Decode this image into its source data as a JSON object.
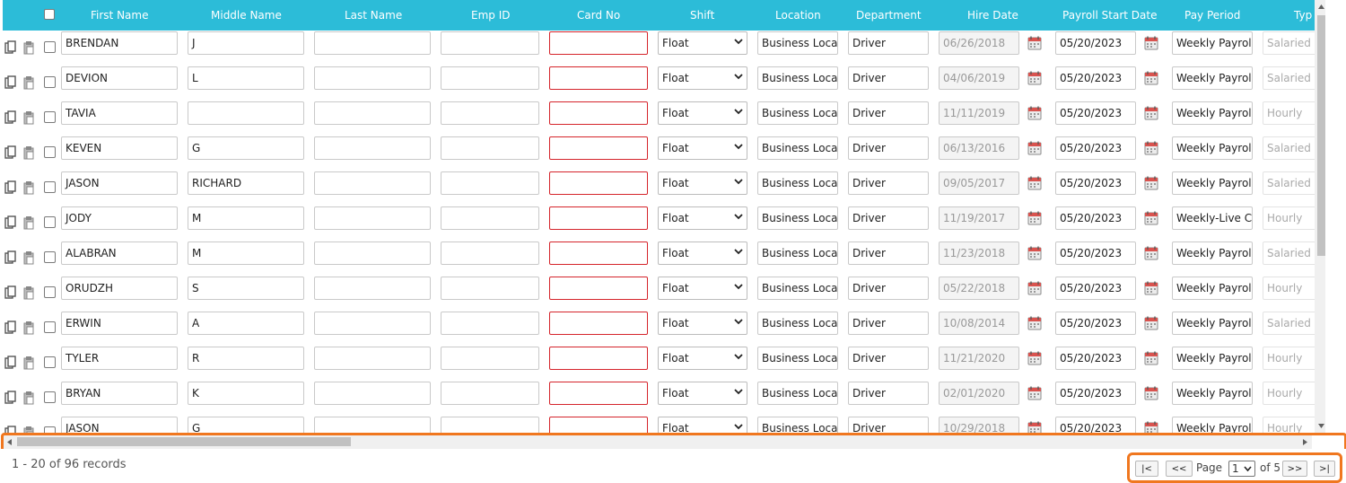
{
  "columns": {
    "first_name": "First Name",
    "middle_name": "Middle Name",
    "last_name": "Last Name",
    "emp_id": "Emp ID",
    "card_no": "Card No",
    "shift": "Shift",
    "location": "Location",
    "department": "Department",
    "hire_date": "Hire Date",
    "payroll_start_date": "Payroll Start Date",
    "pay_period": "Pay Period",
    "type": "Typ"
  },
  "rows": [
    {
      "first": "BRENDAN",
      "middle": "J",
      "last": "",
      "emp_id": "",
      "card": "",
      "shift": "Float",
      "location": "Business Locat",
      "department": "Driver",
      "hire": "06/26/2018",
      "payroll_start": "05/20/2023",
      "pay_period": "Weekly Payroll",
      "type": "Salaried"
    },
    {
      "first": "DEVION",
      "middle": "L",
      "last": "",
      "emp_id": "",
      "card": "",
      "shift": "Float",
      "location": "Business Locat",
      "department": "Driver",
      "hire": "04/06/2019",
      "payroll_start": "05/20/2023",
      "pay_period": "Weekly Payroll",
      "type": "Salaried"
    },
    {
      "first": "TAVIA",
      "middle": "",
      "last": "",
      "emp_id": "",
      "card": "",
      "shift": "Float",
      "location": "Business Locat",
      "department": "Driver",
      "hire": "11/11/2019",
      "payroll_start": "05/20/2023",
      "pay_period": "Weekly Payroll",
      "type": "Hourly"
    },
    {
      "first": "KEVEN",
      "middle": "G",
      "last": "",
      "emp_id": "",
      "card": "",
      "shift": "Float",
      "location": "Business Locat",
      "department": "Driver",
      "hire": "06/13/2016",
      "payroll_start": "05/20/2023",
      "pay_period": "Weekly Payroll",
      "type": "Salaried"
    },
    {
      "first": "JASON",
      "middle": "RICHARD",
      "last": "",
      "emp_id": "",
      "card": "",
      "shift": "Float",
      "location": "Business Locat",
      "department": "Driver",
      "hire": "09/05/2017",
      "payroll_start": "05/20/2023",
      "pay_period": "Weekly Payroll",
      "type": "Salaried"
    },
    {
      "first": "JODY",
      "middle": "M",
      "last": "",
      "emp_id": "",
      "card": "",
      "shift": "Float",
      "location": "Business Locat",
      "department": "Driver",
      "hire": "11/19/2017",
      "payroll_start": "05/20/2023",
      "pay_period": "Weekly-Live Ch",
      "type": "Hourly"
    },
    {
      "first": "ALABRAN",
      "middle": "M",
      "last": "",
      "emp_id": "",
      "card": "",
      "shift": "Float",
      "location": "Business Locat",
      "department": "Driver",
      "hire": "11/23/2018",
      "payroll_start": "05/20/2023",
      "pay_period": "Weekly Payroll",
      "type": "Salaried"
    },
    {
      "first": "ORUDZH",
      "middle": "S",
      "last": "",
      "emp_id": "",
      "card": "",
      "shift": "Float",
      "location": "Business Locat",
      "department": "Driver",
      "hire": "05/22/2018",
      "payroll_start": "05/20/2023",
      "pay_period": "Weekly Payroll",
      "type": "Hourly"
    },
    {
      "first": "ERWIN",
      "middle": "A",
      "last": "",
      "emp_id": "",
      "card": "",
      "shift": "Float",
      "location": "Business Locat",
      "department": "Driver",
      "hire": "10/08/2014",
      "payroll_start": "05/20/2023",
      "pay_period": "Weekly Payroll",
      "type": "Salaried"
    },
    {
      "first": "TYLER",
      "middle": "R",
      "last": "",
      "emp_id": "",
      "card": "",
      "shift": "Float",
      "location": "Business Locat",
      "department": "Driver",
      "hire": "11/21/2020",
      "payroll_start": "05/20/2023",
      "pay_period": "Weekly Payroll",
      "type": "Hourly"
    },
    {
      "first": "BRYAN",
      "middle": "K",
      "last": "",
      "emp_id": "",
      "card": "",
      "shift": "Float",
      "location": "Business Locat",
      "department": "Driver",
      "hire": "02/01/2020",
      "payroll_start": "05/20/2023",
      "pay_period": "Weekly Payroll",
      "type": "Hourly"
    },
    {
      "first": "JASON",
      "middle": "G",
      "last": "",
      "emp_id": "",
      "card": "",
      "shift": "Float",
      "location": "Business Locat",
      "department": "Driver",
      "hire": "10/29/2018",
      "payroll_start": "05/20/2023",
      "pay_period": "Weekly Payroll",
      "type": "Hourly"
    }
  ],
  "footer": {
    "records": "1 - 20 of 96 records",
    "first_btn": "|<",
    "prev_btn": "<<",
    "page_label": "Page",
    "page_value": "1",
    "of_label": "of 5",
    "next_btn": ">>",
    "last_btn": ">|"
  },
  "colors": {
    "header_bg": "#2cbcd8",
    "highlight": "#f0771f",
    "invalid_border": "#d5242b"
  }
}
